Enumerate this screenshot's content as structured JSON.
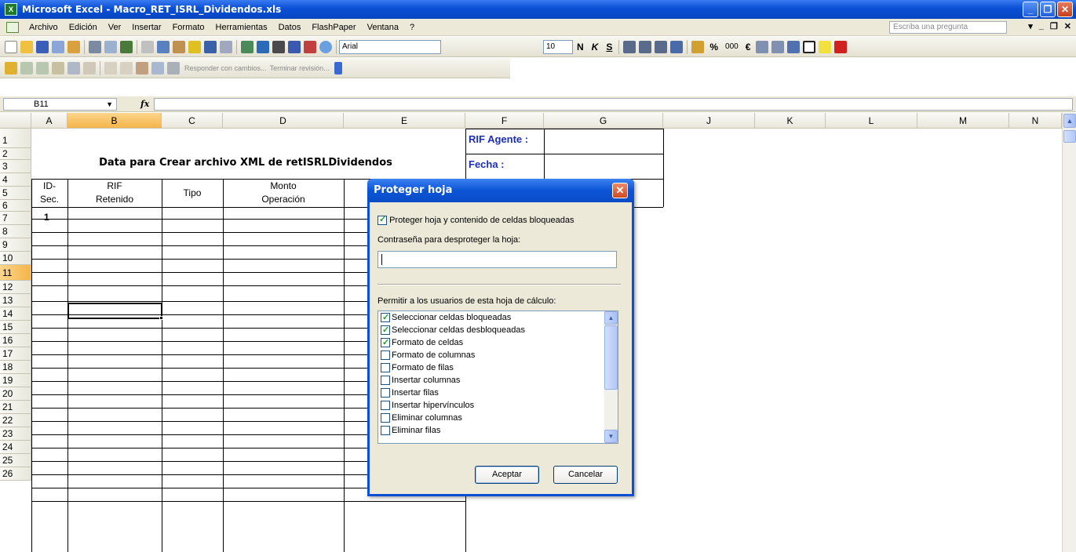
{
  "window": {
    "title": "Microsoft Excel - Macro_RET_ISRL_Dividendos.xls",
    "app_icon": "excel-icon",
    "minimize": "_",
    "restore": "❐",
    "close": "✕"
  },
  "menu": {
    "items": [
      "Archivo",
      "Edición",
      "Ver",
      "Insertar",
      "Formato",
      "Herramientas",
      "Datos",
      "FlashPaper",
      "Ventana",
      "?"
    ],
    "ask_placeholder": "Escriba una pregunta",
    "doc_controls": [
      "▾",
      "_",
      "❐",
      "✕"
    ]
  },
  "toolbar": {
    "font_name": "Arial",
    "font_size": "10",
    "bold": "N",
    "italic": "K",
    "underline": "S",
    "percent": "%",
    "thousands": "000",
    "euro": "€",
    "review_reply": "Responder con cambios...",
    "review_end": "Terminar revisión..."
  },
  "formula_bar": {
    "name_box": "B11",
    "fx": "fx",
    "value": ""
  },
  "sheet": {
    "columns": [
      "A",
      "B",
      "C",
      "D",
      "E",
      "F",
      "G",
      "J",
      "K",
      "L",
      "M",
      "N"
    ],
    "selected_column": "B",
    "rows": [
      "1",
      "2",
      "3",
      "4",
      "5",
      "6",
      "7",
      "8",
      "9",
      "10",
      "11",
      "12",
      "13",
      "14",
      "15",
      "16",
      "17",
      "18",
      "19",
      "20",
      "21",
      "22",
      "23",
      "24",
      "25",
      "26"
    ],
    "selected_row": "11",
    "title": "Data para Crear archivo XML de retISRLDividendos",
    "rif_agente_label": "RIF Agente :",
    "fecha_label": "Fecha :",
    "headers": {
      "id_line1": "ID-",
      "id_line2": "Sec.",
      "rif_line1": "RIF",
      "rif_line2": "Retenido",
      "tipo": "Tipo",
      "monto_line1": "Monto",
      "monto_line2": "Operación"
    },
    "first_id": "1"
  },
  "dialog": {
    "title": "Proteger hoja",
    "protect_checkbox_label": "Proteger hoja y contenido de celdas bloqueadas",
    "protect_checked": true,
    "password_label": "Contraseña para desproteger la hoja:",
    "password_value": "",
    "permissions_label": "Permitir a los usuarios de esta hoja de cálculo:",
    "permissions": [
      {
        "label": "Seleccionar celdas bloqueadas",
        "checked": true
      },
      {
        "label": "Seleccionar celdas desbloqueadas",
        "checked": true
      },
      {
        "label": "Formato de celdas",
        "checked": true
      },
      {
        "label": "Formato de columnas",
        "checked": false
      },
      {
        "label": "Formato de filas",
        "checked": false
      },
      {
        "label": "Insertar columnas",
        "checked": false
      },
      {
        "label": "Insertar filas",
        "checked": false
      },
      {
        "label": "Insertar hipervínculos",
        "checked": false
      },
      {
        "label": "Eliminar columnas",
        "checked": false
      },
      {
        "label": "Eliminar filas",
        "checked": false
      }
    ],
    "ok_label": "Aceptar",
    "cancel_label": "Cancelar"
  }
}
